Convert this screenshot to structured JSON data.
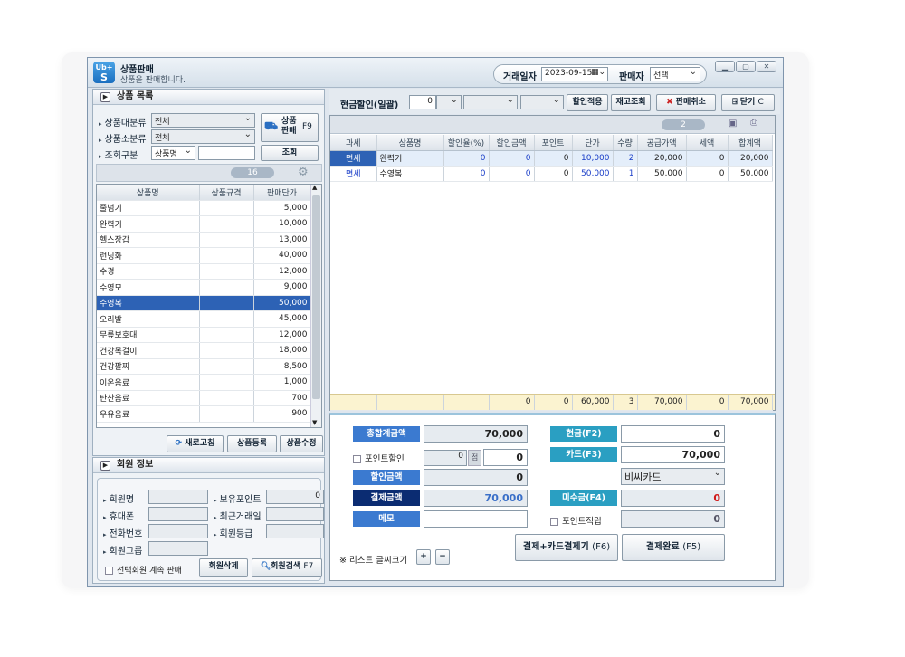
{
  "window": {
    "title": "상품판매",
    "subtitle": "상품을 판매합니다.",
    "logo_top": "Ub+",
    "logo_bottom": "S",
    "date_label": "거래일자",
    "date_value": "2023-09-15",
    "seller_label": "판매자",
    "seller_value": "선택"
  },
  "left": {
    "product_section": "상품 목록",
    "filter": {
      "cat1_label": "상품대분류",
      "cat1_value": "전체",
      "cat2_label": "상품소분류",
      "cat2_value": "전체",
      "search_label": "조회구분",
      "search_type": "상품명",
      "search_value": "",
      "search_button": "조회",
      "sell_button_line1": "상품",
      "sell_button_line2": "판매",
      "sell_key": "F9"
    },
    "count": "16",
    "columns": [
      "상품명",
      "상품규격",
      "판매단가"
    ],
    "products": [
      {
        "name": "줄넘기",
        "spec": "",
        "price": "5,000"
      },
      {
        "name": "완력기",
        "spec": "",
        "price": "10,000"
      },
      {
        "name": "헬스장갑",
        "spec": "",
        "price": "13,000"
      },
      {
        "name": "런닝화",
        "spec": "",
        "price": "40,000"
      },
      {
        "name": "수경",
        "spec": "",
        "price": "12,000"
      },
      {
        "name": "수영모",
        "spec": "",
        "price": "9,000"
      },
      {
        "name": "수영복",
        "spec": "",
        "price": "50,000"
      },
      {
        "name": "오리발",
        "spec": "",
        "price": "45,000"
      },
      {
        "name": "무릎보호대",
        "spec": "",
        "price": "12,000"
      },
      {
        "name": "건강목걸이",
        "spec": "",
        "price": "18,000"
      },
      {
        "name": "건강팔찌",
        "spec": "",
        "price": "8,500"
      },
      {
        "name": "이온음료",
        "spec": "",
        "price": "1,000"
      },
      {
        "name": "탄산음료",
        "spec": "",
        "price": "700"
      },
      {
        "name": "우유음료",
        "spec": "",
        "price": "900"
      }
    ],
    "selected_index": 6,
    "buttons": {
      "refresh": "새로고침",
      "register": "상품등록",
      "edit": "상품수정"
    },
    "member_section": "회원 정보",
    "member": {
      "name": "회원명",
      "phone": "휴대폰",
      "tel": "전화번호",
      "group": "회원그룹",
      "points": "보유포인트",
      "points_value": "0",
      "recent": "최근거래일",
      "grade": "회원등급",
      "continue": "선택회원 계속 판매",
      "delete": "회원삭제",
      "search": "회원검색",
      "search_key": "F7"
    }
  },
  "right": {
    "toolbar": {
      "cash_discount": "현금할인(일괄)",
      "discount_value": "0",
      "apply": "할인적용",
      "stock": "재고조회",
      "cancel": "판매취소",
      "close": "닫기",
      "close_key": "C"
    },
    "count": "2",
    "columns": [
      "과세",
      "상품명",
      "할인율(%)",
      "할인금액",
      "포인트",
      "단가",
      "수량",
      "공급가액",
      "세액",
      "합계액"
    ],
    "rows": [
      {
        "tax": "면세",
        "name": "완력기",
        "rate": "0",
        "disc": "0",
        "point": "0",
        "price": "10,000",
        "qty": "2",
        "supply": "20,000",
        "vat": "0",
        "total": "20,000"
      },
      {
        "tax": "면세",
        "name": "수영복",
        "rate": "0",
        "disc": "0",
        "point": "0",
        "price": "50,000",
        "qty": "1",
        "supply": "50,000",
        "vat": "0",
        "total": "50,000"
      }
    ],
    "totals": {
      "disc": "0",
      "point": "0",
      "price": "60,000",
      "qty": "3",
      "supply": "70,000",
      "vat": "0",
      "total": "70,000"
    },
    "pay": {
      "total_label": "총합계금액",
      "total": "70,000",
      "point_disc_label": "포인트할인",
      "point_disc_input": "0",
      "point_unit": "점",
      "point_disc_value": "0",
      "discount_label": "할인금액",
      "discount": "0",
      "settle_label": "결제금액",
      "settle": "70,000",
      "memo_label": "메모",
      "cash_label": "현금(F2)",
      "cash": "0",
      "card_label": "카드(F3)",
      "card": "70,000",
      "card_company": "비씨카드",
      "unpaid_label": "미수금(F4)",
      "unpaid": "0",
      "point_save_label": "포인트적립",
      "point_save": "0",
      "font_size_label": "※ 리스트 글씨크기",
      "plus": "+",
      "minus": "−",
      "pay_card": "결제+카드결제기",
      "pay_card_key": "(F6)",
      "complete": "결제완료",
      "complete_key": "(F5)"
    }
  }
}
